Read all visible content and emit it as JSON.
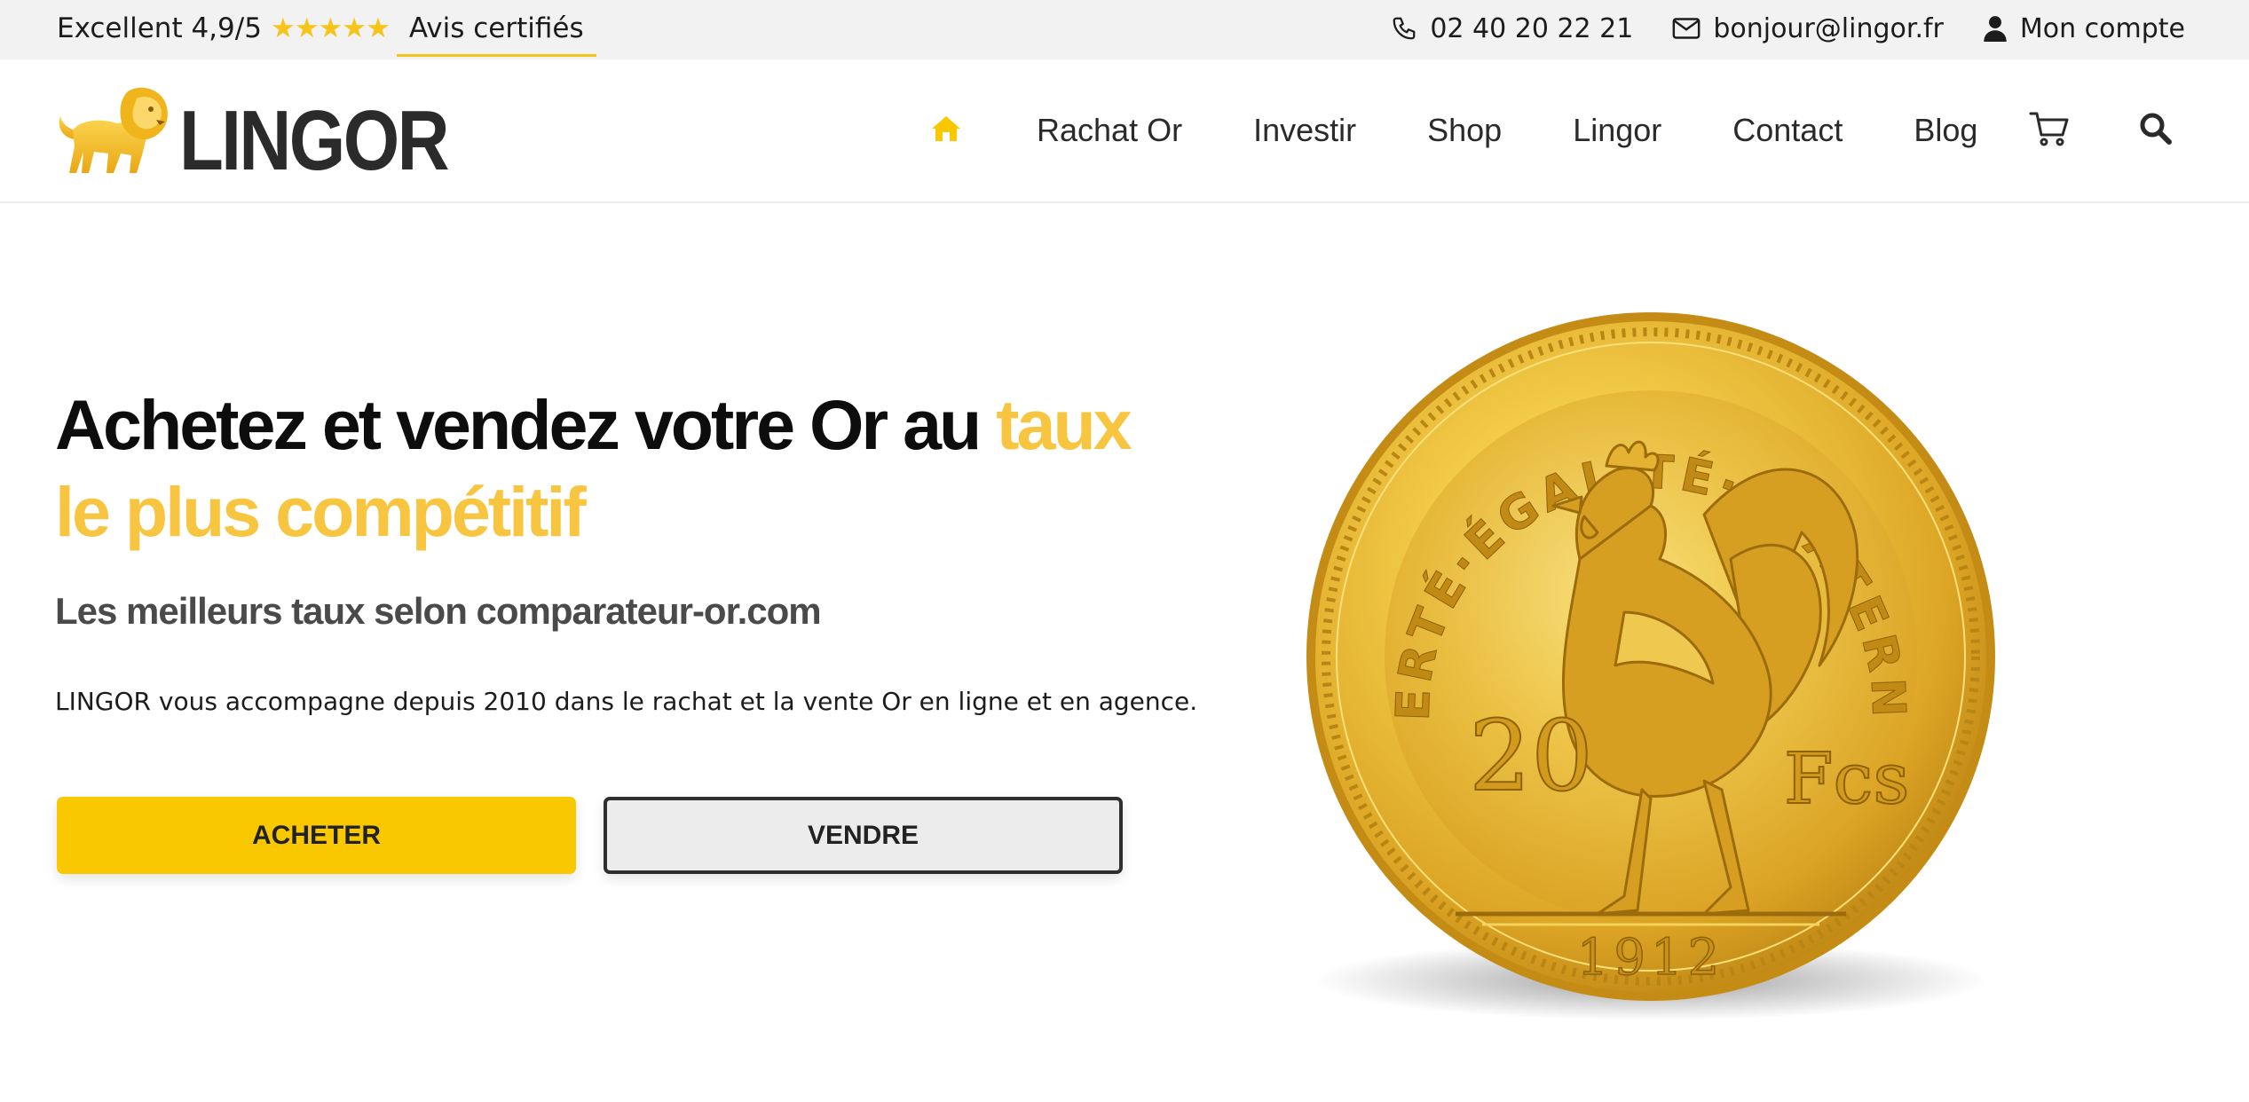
{
  "topbar": {
    "rating_text": "Excellent 4,9/5",
    "stars": "★★★★★",
    "reviews_link": "Avis certifiés",
    "phone": "02 40 20 22 21",
    "email": "bonjour@lingor.fr",
    "account": "Mon compte",
    "phone_icon": "phone-icon",
    "email_icon": "envelope-icon",
    "account_icon": "user-icon"
  },
  "header": {
    "logo_text": "LINGOR",
    "logo_icon": "lion-icon",
    "nav": {
      "home_icon": "home-icon",
      "items": [
        "Rachat Or",
        "Investir",
        "Shop",
        "Lingor",
        "Contact",
        "Blog"
      ],
      "cart_icon": "cart-icon",
      "search_icon": "search-icon"
    }
  },
  "hero": {
    "title_dark": "Achetez et vendez votre Or au ",
    "title_highlight": "taux le plus compétitif",
    "subtitle": "Les meilleurs taux selon comparateur-or.com",
    "text": "LINGOR vous accompagne depuis 2010 dans le rachat et la vente Or en ligne et en agence.",
    "buy_button": "ACHETER",
    "sell_button": "VENDRE",
    "coin": {
      "legend": "LIBERTÉ·ÉGALITÉ·FRATERNITÉ",
      "value": "20",
      "unit": "Fcs",
      "year": "1912"
    }
  },
  "colors": {
    "accent": "#f7c540",
    "button_yellow": "#f9c800",
    "topbar_bg": "#f2f2f2",
    "text_dark": "#0d0d0d",
    "gold": "#e2b02a"
  }
}
